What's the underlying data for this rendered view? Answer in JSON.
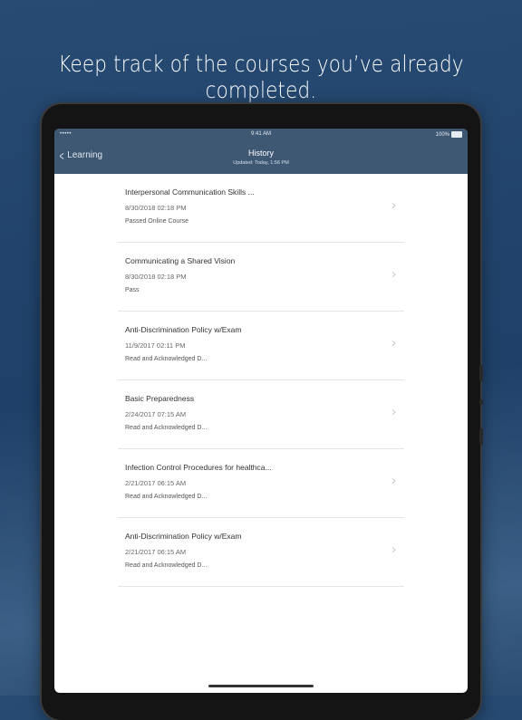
{
  "headline": "Keep track of the courses you’ve already completed.",
  "status_bar": {
    "signal": "•••••",
    "time": "9:41 AM",
    "battery": "100%"
  },
  "nav": {
    "back_label": "Learning",
    "title": "History",
    "subtitle": "Updated: Today, 1:56 PM"
  },
  "history": [
    {
      "title": "Interpersonal Communication Skills ...",
      "date": "8/30/2018   02:18 PM",
      "status": "Passed Online Course"
    },
    {
      "title": "Communicating a Shared Vision",
      "date": "8/30/2018   02:18 PM",
      "status": "Pass"
    },
    {
      "title": "Anti-Discrimination Policy w/Exam",
      "date": "11/9/2017    02:11 PM",
      "status": "Read and Acknowledged D..."
    },
    {
      "title": "Basic Preparedness",
      "date": "2/24/2017    07:15 AM",
      "status": "Read and Acknowledged D..."
    },
    {
      "title": "Infection Control Procedures for healthca...",
      "date": "2/21/2017    06:15 AM",
      "status": "Read and Acknowledged D..."
    },
    {
      "title": "Anti-Discrimination Policy w/Exam",
      "date": "2/21/2017    06:15 AM",
      "status": "Read and Acknowledged D..."
    }
  ],
  "colors": {
    "navbar": "#3e5873",
    "background": "#274b73"
  },
  "icons": {
    "back": "chevron-left-icon",
    "row": "chevron-right-icon"
  }
}
